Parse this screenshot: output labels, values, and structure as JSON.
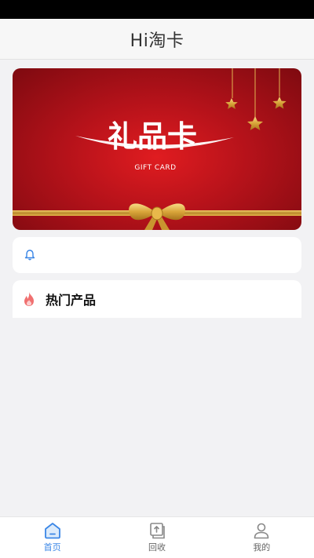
{
  "header": {
    "title": "Hi淘卡"
  },
  "banner": {
    "main_text": "礼品卡",
    "sub_text": "GIFT CARD"
  },
  "notice": {
    "icon": "bell-icon",
    "text": ""
  },
  "hot_products": {
    "icon": "flame-icon",
    "title": "热门产品"
  },
  "tabbar": {
    "items": [
      {
        "label": "首页",
        "icon": "home-icon",
        "active": true
      },
      {
        "label": "回收",
        "icon": "recycle-icon",
        "active": false
      },
      {
        "label": "我的",
        "icon": "user-icon",
        "active": false
      }
    ]
  },
  "colors": {
    "accent": "#3a86e6",
    "banner_red": "#c4141a",
    "gold": "#e8b84a",
    "flame": "#f06060"
  }
}
